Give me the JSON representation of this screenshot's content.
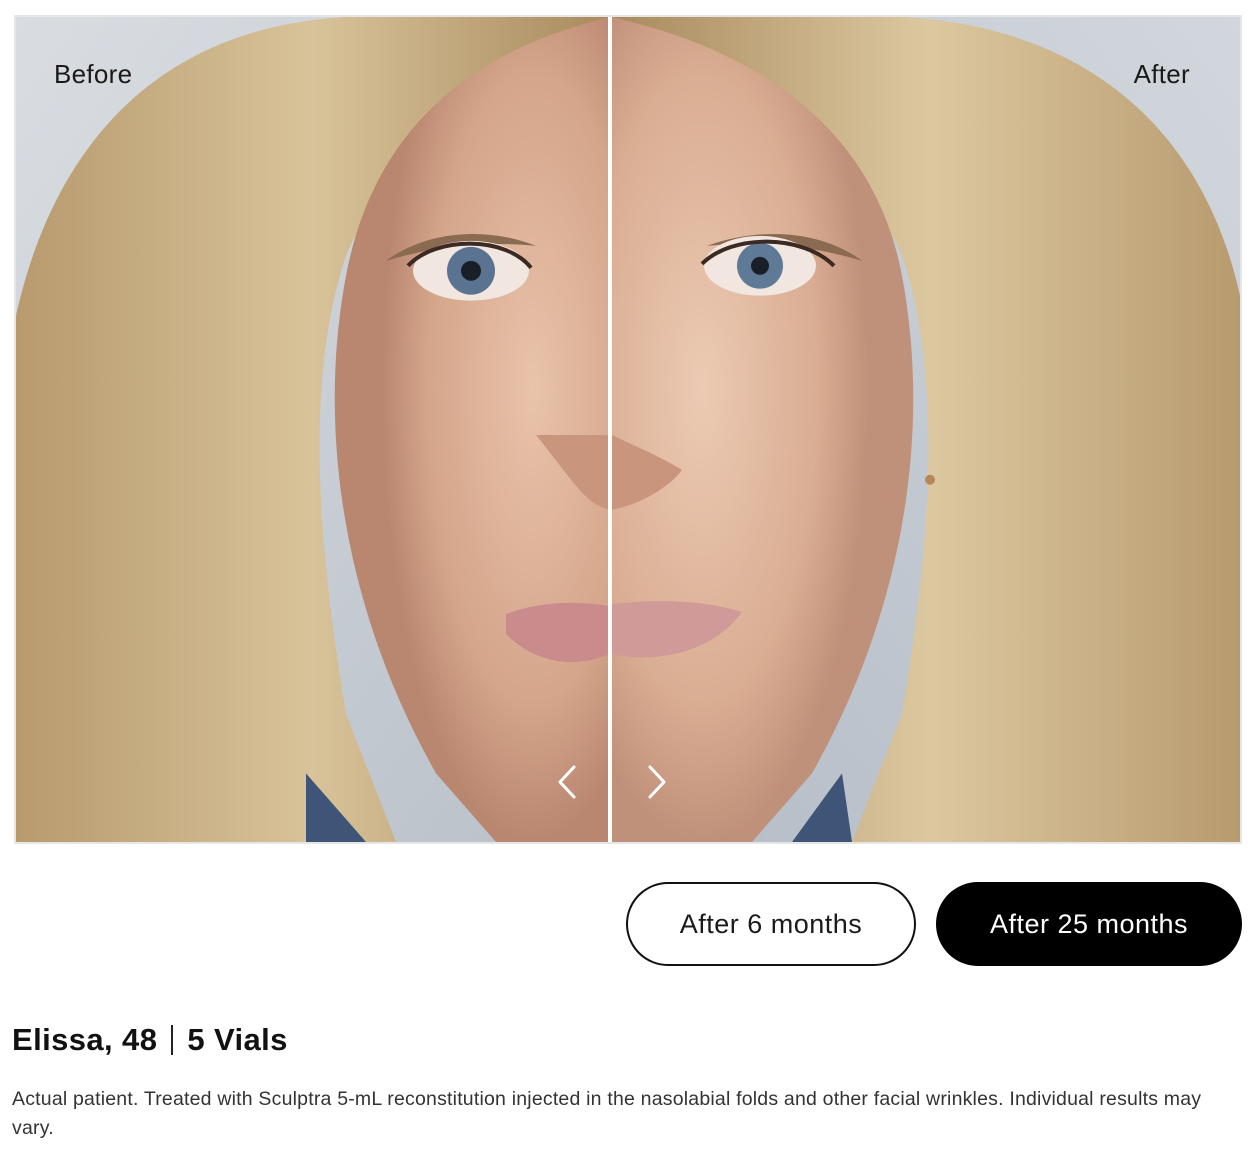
{
  "comparison": {
    "before_label": "Before",
    "after_label": "After",
    "prev_icon": "chevron-left-icon",
    "next_icon": "chevron-right-icon"
  },
  "timeframes": {
    "options": [
      "After 6 months",
      "After 25 months"
    ],
    "selected": "After 25 months"
  },
  "patient": {
    "name_age": "Elissa, 48",
    "vials": "5 Vials",
    "disclaimer": "Actual patient. Treated with Sculptra 5-mL reconstitution injected in the nasolabial folds and other facial wrinkles. Individual results may vary."
  },
  "colors": {
    "selected_pill_bg": "#000000",
    "unselected_pill_border": "#111111",
    "divider": "#ffffff"
  }
}
